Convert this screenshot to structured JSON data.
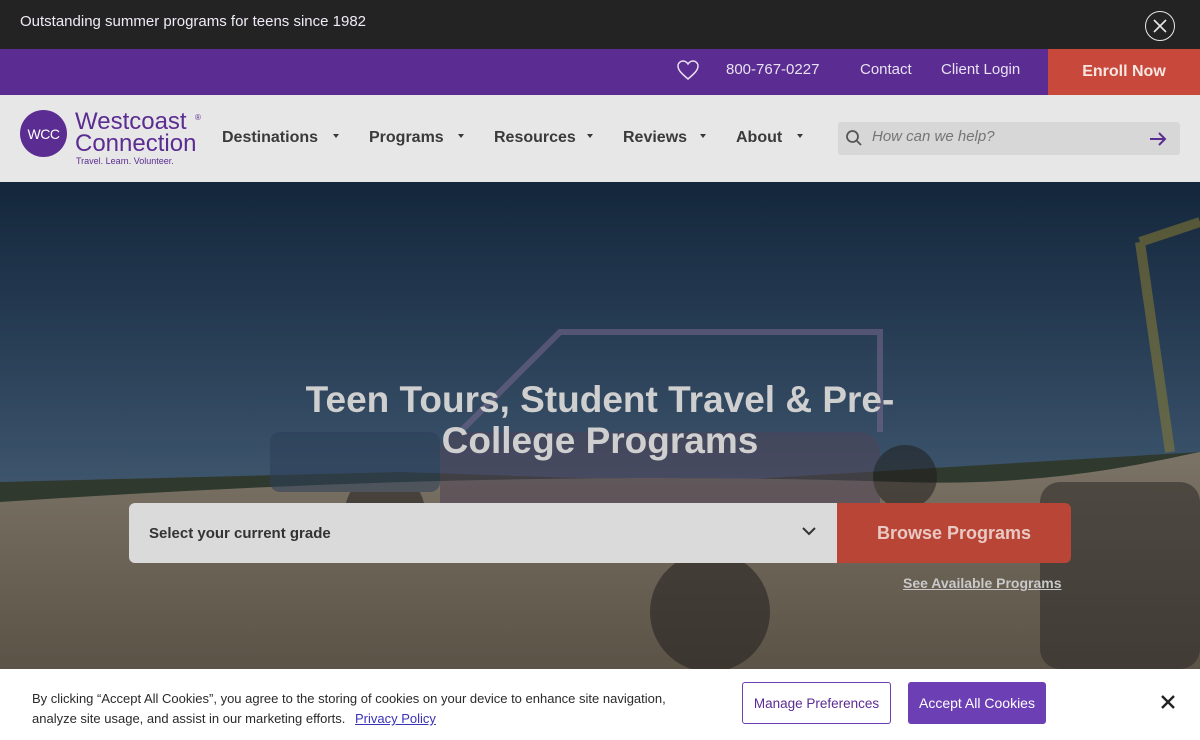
{
  "announcement": {
    "text": "Outstanding summer programs for teens since 1982",
    "phone": "800-767-0227",
    "contact": "Contact",
    "client_login": "Client Login",
    "enroll": "Enroll Now"
  },
  "logo": {
    "mark": "WCC",
    "name_line1": "Westcoast",
    "name_line2": "Connection",
    "registered": "®",
    "tagline": "Travel. Learn. Volunteer."
  },
  "nav": {
    "items": [
      {
        "label": "Destinations"
      },
      {
        "label": "Programs"
      },
      {
        "label": "Resources"
      },
      {
        "label": "Reviews"
      },
      {
        "label": "About"
      }
    ]
  },
  "search": {
    "placeholder": "How can we help?"
  },
  "hero": {
    "title": "Teen Tours, Student Travel & Pre-College Programs",
    "grade_select": "Select your current grade",
    "browse_button": "Browse Programs",
    "see_available": "See Available Programs"
  },
  "cookie": {
    "text": "By clicking “Accept All Cookies”, you agree to the storing of cookies on your device to enhance site navigation, analyze site usage, and assist in our marketing efforts.",
    "privacy_link": "Privacy Policy",
    "manage_button": "Manage Preferences",
    "accept_button": "Accept All Cookies"
  },
  "colors": {
    "brand_purple": "#5b2c91",
    "accent_red": "#c8493c",
    "overlay_dark": "#232323"
  },
  "icons": [
    "close-icon",
    "heart-icon",
    "search-icon",
    "arrow-right-icon",
    "chevron-down-icon"
  ]
}
